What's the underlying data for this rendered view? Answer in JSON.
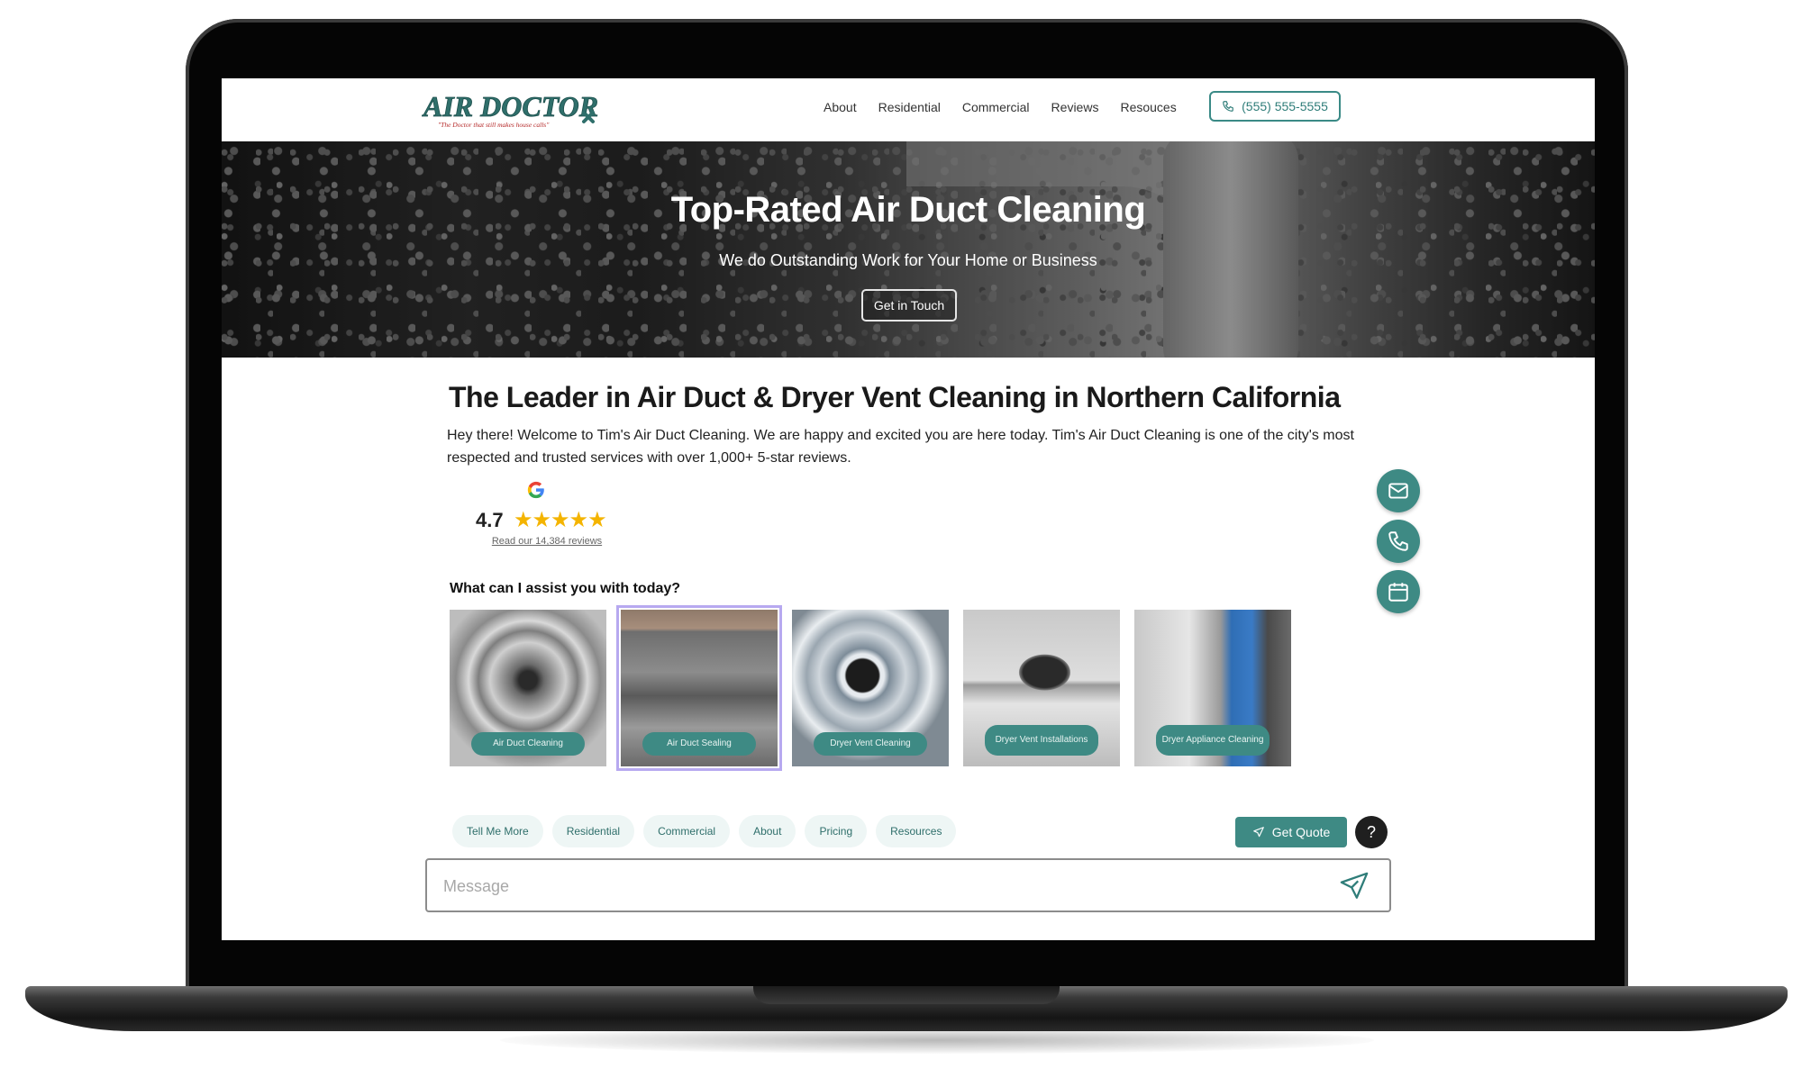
{
  "brand": {
    "name": "AIR DOCTOR",
    "tagline": "\"The Doctor that still makes house calls\""
  },
  "nav": {
    "links": [
      "About",
      "Residential",
      "Commercial",
      "Reviews",
      "Resouces"
    ],
    "phone": "(555) 555-5555"
  },
  "hero": {
    "title": "Top-Rated Air Duct Cleaning",
    "subtitle": "We do Outstanding Work for Your Home or Business",
    "cta": "Get in Touch"
  },
  "main": {
    "heading": "The Leader in Air Duct & Dryer Vent Cleaning in Northern California",
    "intro": "Hey there! Welcome to Tim's Air Duct Cleaning. We are happy and excited you are here today. Tim's Air Duct Cleaning is one of the city's most respected and trusted services with over 1,000+ 5-star reviews."
  },
  "rating": {
    "value": "4.7",
    "stars": "★★★★★",
    "reviews_link": "Read our 14,384 reviews"
  },
  "assist": {
    "question": "What can I assist you with today?",
    "cards": [
      {
        "label": "Air Duct Cleaning"
      },
      {
        "label": "Air Duct Sealing",
        "selected": true
      },
      {
        "label": "Dryer Vent Cleaning"
      },
      {
        "label": "Dryer Vent Installations"
      },
      {
        "label": "Dryer Appliance Cleaning"
      }
    ]
  },
  "chips": [
    "Tell Me More",
    "Residential",
    "Commercial",
    "About",
    "Pricing",
    "Resources"
  ],
  "actions": {
    "quote": "Get Quote",
    "help": "?"
  },
  "message": {
    "placeholder": "Message"
  },
  "colors": {
    "accent": "#3e8a84",
    "brand_text": "#2f6f6b"
  },
  "icons": {
    "float": [
      "mail-icon",
      "phone-icon",
      "calendar-icon"
    ],
    "send": "send-icon",
    "quote": "paper-plane-icon"
  }
}
